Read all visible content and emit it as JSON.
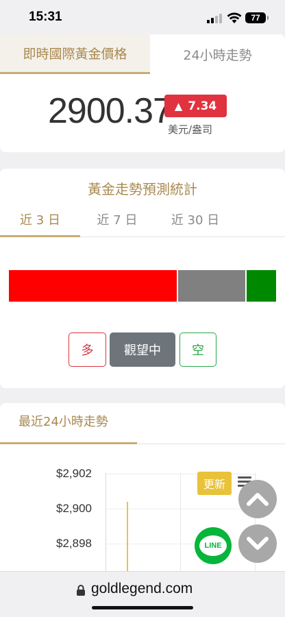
{
  "status_bar": {
    "time": "15:31",
    "battery": "77"
  },
  "price_card": {
    "tabs": [
      {
        "label": "即時國際黃金價格",
        "active": true
      },
      {
        "label": "24小時走勢",
        "active": false
      }
    ],
    "price": "2900.37",
    "change": "7.34",
    "change_arrow": "▲",
    "unit": "美元/盎司",
    "colors": {
      "up": "#e0323f",
      "accent": "#a9884e"
    }
  },
  "forecast": {
    "title": "黃金走勢預測統計",
    "tabs": [
      {
        "label": "近 3 日",
        "active": true
      },
      {
        "label": "近 7 日",
        "active": false
      },
      {
        "label": "近 30 日",
        "active": false
      }
    ],
    "distribution": [
      {
        "key": "bull",
        "share": 0.628,
        "color": "#ff0000"
      },
      {
        "key": "neutral",
        "share": 0.257,
        "color": "#808080"
      },
      {
        "key": "bear",
        "share": 0.115,
        "color": "#008800"
      }
    ],
    "buttons": {
      "bull": "多",
      "neutral": "觀望中",
      "bear": "空"
    }
  },
  "trend": {
    "title": "最近24小時走勢",
    "y_ticks": [
      "$2,902",
      "$2,900",
      "$2,898"
    ],
    "update_label": "更新",
    "line_color": "#e8c24a"
  },
  "floating": {
    "scroll_up_icon": "chevron-up-icon",
    "scroll_down_icon": "chevron-down-icon",
    "line_label": "LINE"
  },
  "browser": {
    "url": "goldlegend.com"
  }
}
